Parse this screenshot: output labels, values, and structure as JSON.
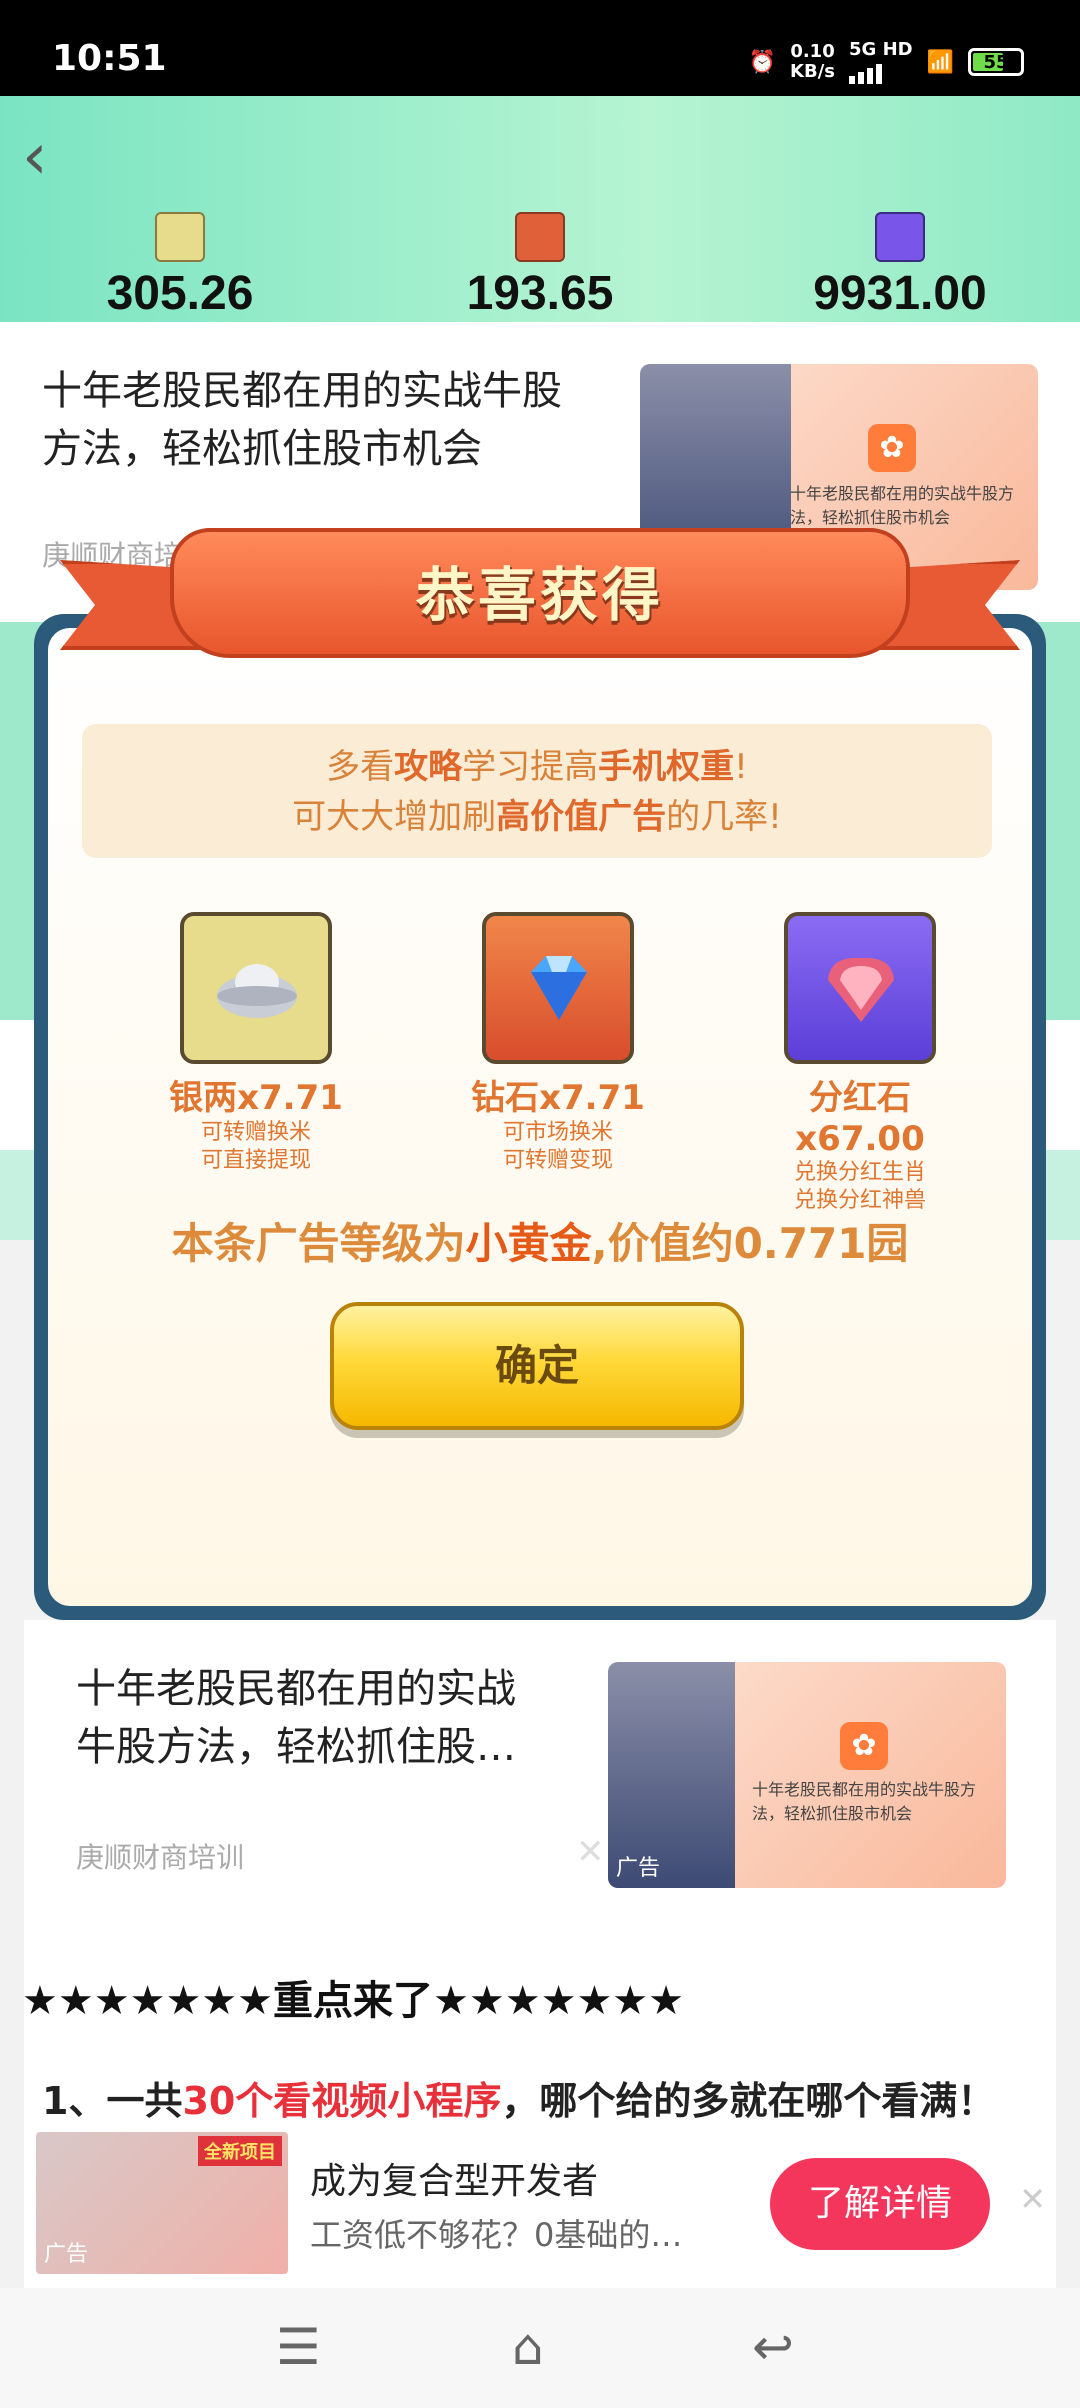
{
  "status_bar": {
    "time": "10:51",
    "net_speed": "0.10",
    "net_unit": "KB/s",
    "network": "5G HD",
    "battery": "55"
  },
  "header": {
    "stats": [
      {
        "value": "305.26",
        "icon": "silver-ingot-icon"
      },
      {
        "value": "193.65",
        "icon": "diamond-icon"
      },
      {
        "value": "9931.00",
        "icon": "ruby-icon"
      }
    ]
  },
  "ad1": {
    "title_line1": "十年老股民都在用的实战牛股",
    "title_line2": "方法，轻松抓住股市机会",
    "source": "庚顺财商培训",
    "thumb_text": "十年老股民都在用的实战牛股方法，轻松抓住股市机会"
  },
  "modal": {
    "title": "恭喜获得",
    "tip_line1_a": "多看",
    "tip_line1_b": "攻略",
    "tip_line1_c": "学习提高",
    "tip_line1_d": "手机权重",
    "tip_line1_e": "!",
    "tip_line2_a": "可大大增加刷",
    "tip_line2_b": "高价值广告",
    "tip_line2_c": "的几率!",
    "rewards": [
      {
        "name": "银两x7.71",
        "desc1": "可转赠换米",
        "desc2": "可直接提现",
        "icon": "silver-ingot-icon"
      },
      {
        "name": "钻石x7.71",
        "desc1": "可市场换米",
        "desc2": "可转赠变现",
        "icon": "diamond-icon"
      },
      {
        "name": "分红石x67.00",
        "desc1": "兑换分红生肖",
        "desc2": "兑换分红神兽",
        "icon": "ruby-icon"
      }
    ],
    "value_prefix": "本条广告等级为",
    "value_level": "小黄金",
    "value_suffix": ",价值约0.771园",
    "confirm_label": "确定"
  },
  "ad2": {
    "title_line1": "十年老股民都在用的实战",
    "title_line2": "牛股方法，轻松抓住股…",
    "source": "庚顺财商培训",
    "thumb_text": "十年老股民都在用的实战牛股方法，轻松抓住股市机会",
    "ad_label": "广告"
  },
  "article": {
    "stars_heading": "★★★★★★★重点来了★★★★★★★",
    "rule1_a": "1、一共",
    "rule1_b": "30个看视频小程序",
    "rule1_c": "，哪个给的多就在哪个看满！"
  },
  "bottom_ad": {
    "tag": "全新项目",
    "ad_label": "广告",
    "title": "成为复合型开发者",
    "subtitle": "工资低不够花？0基础的…",
    "cta": "了解详情"
  }
}
